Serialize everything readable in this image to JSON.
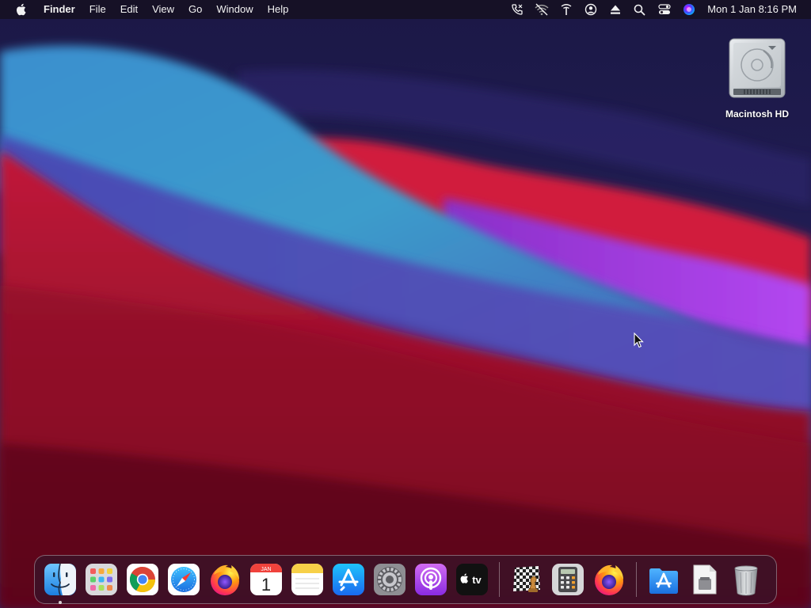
{
  "menubar": {
    "app_name": "Finder",
    "menus": [
      "File",
      "Edit",
      "View",
      "Go",
      "Window",
      "Help"
    ],
    "status_icons": [
      "phone-icon",
      "wifi-off-icon",
      "antenna-icon",
      "user-icon",
      "eject-icon",
      "search-icon",
      "control-center-icon",
      "siri-icon"
    ],
    "clock": "Mon 1 Jan  8:16 PM"
  },
  "desktop": {
    "icons": [
      {
        "label": "Macintosh HD",
        "icon": "hard-drive-icon"
      }
    ]
  },
  "dock": {
    "apps": [
      {
        "name": "Finder",
        "icon": "finder-icon",
        "running": true
      },
      {
        "name": "Launchpad",
        "icon": "launchpad-icon",
        "running": false
      },
      {
        "name": "Google Chrome",
        "icon": "chrome-icon",
        "running": false
      },
      {
        "name": "Safari",
        "icon": "safari-icon",
        "running": false
      },
      {
        "name": "Firefox",
        "icon": "firefox-icon",
        "running": false
      },
      {
        "name": "Calendar",
        "icon": "calendar-icon",
        "running": false,
        "month": "JAN",
        "day": "1"
      },
      {
        "name": "Notes",
        "icon": "notes-icon",
        "running": false
      },
      {
        "name": "App Store",
        "icon": "app-store-icon",
        "running": false
      },
      {
        "name": "System Preferences",
        "icon": "system-preferences-icon",
        "running": false
      },
      {
        "name": "Podcasts",
        "icon": "podcasts-icon",
        "running": false
      },
      {
        "name": "TV",
        "icon": "apple-tv-icon",
        "running": false,
        "label": "tv"
      }
    ],
    "recent_apps": [
      {
        "name": "Chess",
        "icon": "chess-icon"
      },
      {
        "name": "Calculator",
        "icon": "calculator-icon"
      },
      {
        "name": "Firefox",
        "icon": "firefox-icon"
      }
    ],
    "others": [
      {
        "name": "Applications",
        "icon": "applications-folder-icon"
      },
      {
        "name": "Document",
        "icon": "document-icon"
      },
      {
        "name": "Trash",
        "icon": "trash-icon"
      }
    ]
  },
  "colors": {
    "menubar_bg": "#14101e",
    "wallpaper_top": "#1e1a4e",
    "wallpaper_red": "#c8173a",
    "wallpaper_teal": "#38a0c8",
    "wallpaper_purple": "#a03ee0"
  }
}
